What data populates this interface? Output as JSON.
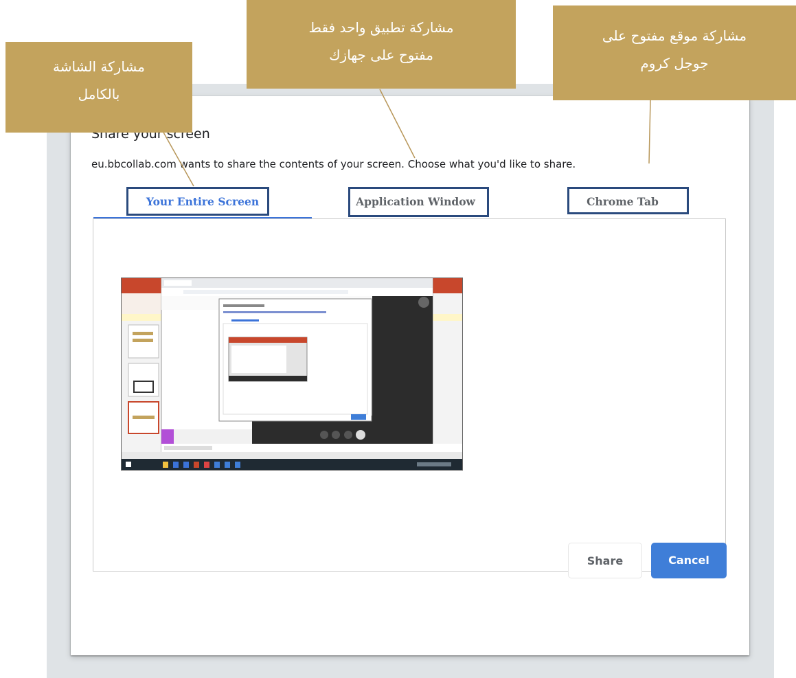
{
  "dialog": {
    "title": "Share your screen",
    "description": "eu.bbcollab.com wants to share the contents of your screen. Choose what you'd like to share.",
    "tabs": [
      {
        "label": "Your Entire Screen",
        "active": true
      },
      {
        "label": "Application Window",
        "active": false
      },
      {
        "label": "Chrome Tab",
        "active": false
      }
    ],
    "share_label": "Share",
    "cancel_label": "Cancel"
  },
  "annotations": {
    "entire_screen": [
      "مشاركة الشاشة",
      "بالكامل"
    ],
    "app_window": [
      "مشاركة تطبيق واحد فقط",
      "مفتوح على جهازك"
    ],
    "chrome_tab": [
      "مشاركة موقع مفتوح على",
      "جوجل كروم"
    ]
  },
  "colors": {
    "accent": "#3b73d9",
    "callout": "#c3a35d",
    "highlight_box": "#2a4a7d"
  }
}
